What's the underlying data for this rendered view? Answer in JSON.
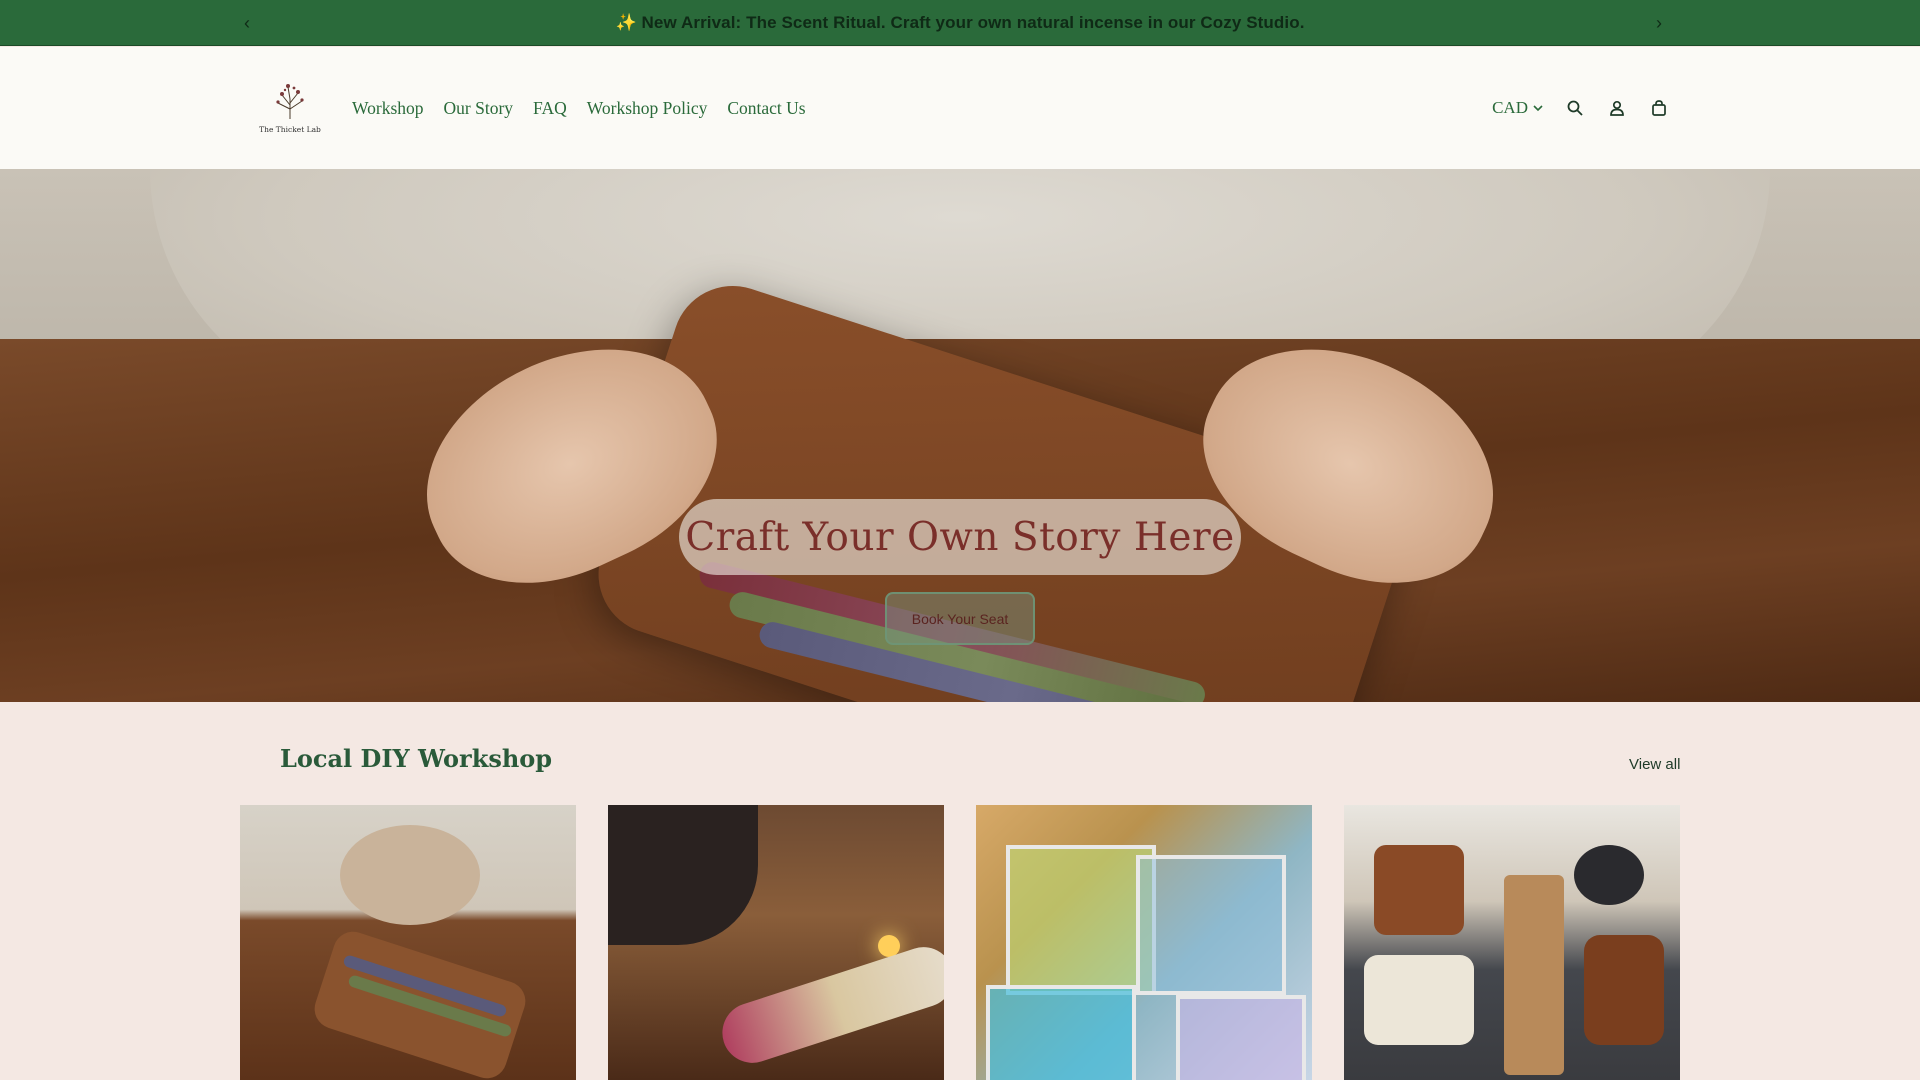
{
  "announcement": {
    "text": "✨ New Arrival: The Scent Ritual. Craft your own natural incense in our Cozy Studio.",
    "prev_label": "‹",
    "next_label": "›"
  },
  "header": {
    "logo_text": "The Thicket Lab",
    "nav": [
      {
        "label": "Workshop"
      },
      {
        "label": "Our Story"
      },
      {
        "label": "FAQ"
      },
      {
        "label": "Workshop Policy"
      },
      {
        "label": "Contact Us"
      }
    ],
    "currency": "CAD",
    "icons": [
      "search-icon",
      "account-icon",
      "cart-icon"
    ]
  },
  "hero": {
    "title": "Craft Your Own Story Here",
    "button_label": "Book Your Seat"
  },
  "workshops": {
    "title": "Local DIY Workshop",
    "view_all_label": "View all"
  },
  "colors": {
    "announcement_bg": "#2a6a3a",
    "header_bg": "#fbfaf6",
    "nav_text": "#2a6a3a",
    "hero_title": "#7a2f2a",
    "section_bg": "#f4e8e3"
  }
}
